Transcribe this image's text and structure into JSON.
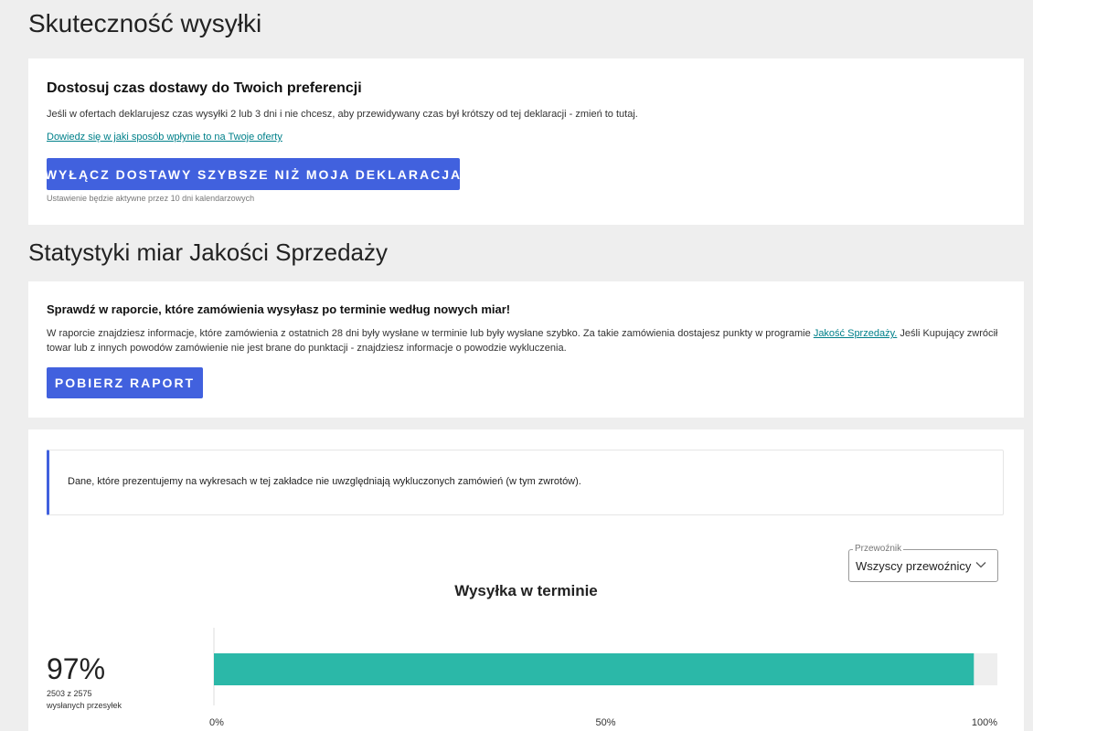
{
  "section1": {
    "title": "Skuteczność wysyłki"
  },
  "delivery_card": {
    "heading": "Dostosuj czas dostawy do Twoich preferencji",
    "text": "Jeśli w ofertach deklarujesz czas wysyłki 2 lub 3 dni i nie chcesz, aby przewidywany czas był krótszy od tej deklaracji - zmień to tutaj.",
    "link": "Dowiedz się w jaki sposób wpłynie to na Twoje oferty",
    "button": "WYŁĄCZ DOSTAWY SZYBSZE NIŻ MOJA DEKLARACJA",
    "hint": "Ustawienie będzie aktywne przez 10 dni kalendarzowych"
  },
  "section2": {
    "title": "Statystyki miar Jakości Sprzedaży"
  },
  "report_card": {
    "heading": "Sprawdź w raporcie, które zamówienia wysyłasz po terminie według nowych miar!",
    "text_before": "W raporcie znajdziesz informacje, które zamówienia z ostatnich 28 dni były wysłane w terminie lub były wysłane szybko. Za takie zamówienia dostajesz punkty w programie ",
    "link": "Jakość Sprzedaży.",
    "text_after": " Jeśli Kupujący zwrócił towar lub z innych powodów zamówienie nie jest brane do punktacji - znajdziesz informacje o powodzie wykluczenia.",
    "button": "POBIERZ RAPORT"
  },
  "info_box": {
    "text": "Dane, które prezentujemy na wykresach w tej zakładce nie uwzględniają wykluczonych zamówień (w tym zwrotów)."
  },
  "carrier_select": {
    "legend": "Przewoźnik",
    "value": "Wszyscy przewoźnicy",
    "icon": "chevron-down-icon"
  },
  "stats": {
    "percent": "97%",
    "count_line": "2503 z 2575",
    "count_label": "wysłanych przesyłek"
  },
  "colors": {
    "accent": "#4161de",
    "link": "#00808a",
    "bar": "#2bb8a8",
    "bar_track": "#eeeeee"
  },
  "chart_data": {
    "type": "bar",
    "orientation": "horizontal",
    "title": "Wysyłka w terminie",
    "categories": [
      ""
    ],
    "values": [
      97
    ],
    "xlim": [
      0,
      100
    ],
    "x_tick_labels": [
      "0%",
      "50%",
      "100%"
    ],
    "x_ticks": [
      0,
      50,
      100
    ],
    "grid": false
  }
}
